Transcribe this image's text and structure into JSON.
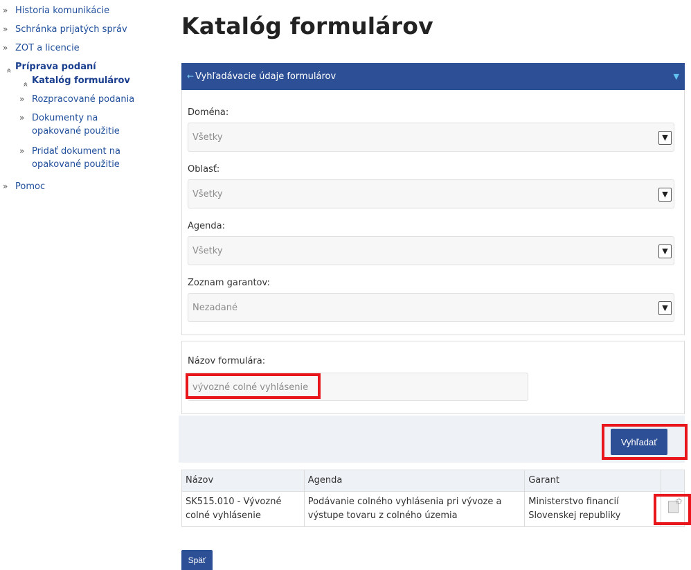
{
  "sidebar": {
    "items": [
      {
        "label": "Historia komunikácie",
        "chev": "»"
      },
      {
        "label": "Schránka prijatých správ",
        "chev": "»"
      },
      {
        "label": "ZOT a licencie",
        "chev": "»"
      },
      {
        "label": "Príprava podaní",
        "chev": "«"
      },
      {
        "label": "Katalóg formulárov",
        "chev": "«"
      },
      {
        "label": "Rozpracované podania",
        "chev": "»"
      },
      {
        "label": "Dokumenty na opakované použitie",
        "chev": "»"
      },
      {
        "label": "Pridať dokument na opakované použitie",
        "chev": "»"
      },
      {
        "label": "Pomoc",
        "chev": "»"
      }
    ]
  },
  "page": {
    "title": "Katalóg formulárov"
  },
  "search_panel": {
    "header": "Vyhľadávacie údaje formulárov",
    "header_icon": "arrow-left-icon",
    "toggle_icon": "chevron-down-icon",
    "fields": [
      {
        "label": "Doména:",
        "value": "Všetky"
      },
      {
        "label": "Oblasť:",
        "value": "Všetky"
      },
      {
        "label": "Agenda:",
        "value": "Všetky"
      },
      {
        "label": "Zoznam garantov:",
        "value": "Nezadané"
      }
    ]
  },
  "name_search": {
    "label": "Názov formulára:",
    "value": "vývozné colné vyhlásenie"
  },
  "buttons": {
    "search": "Vyhľadať",
    "back": "Späť"
  },
  "results": {
    "columns": [
      "Názov",
      "Agenda",
      "Garant"
    ],
    "rows": [
      {
        "name": "SK515.010 - Vývozné colné vyhlásenie",
        "agenda": "Podávanie colného vyhlásenia pri vývoze a výstupe tovaru z colného územia",
        "garant": "Ministerstvo financií Slovenskej republiky",
        "icon": "add-document-icon"
      }
    ]
  },
  "colors": {
    "primary": "#2d4f96",
    "highlight": "#e8161a",
    "link": "#1f4e9b"
  }
}
